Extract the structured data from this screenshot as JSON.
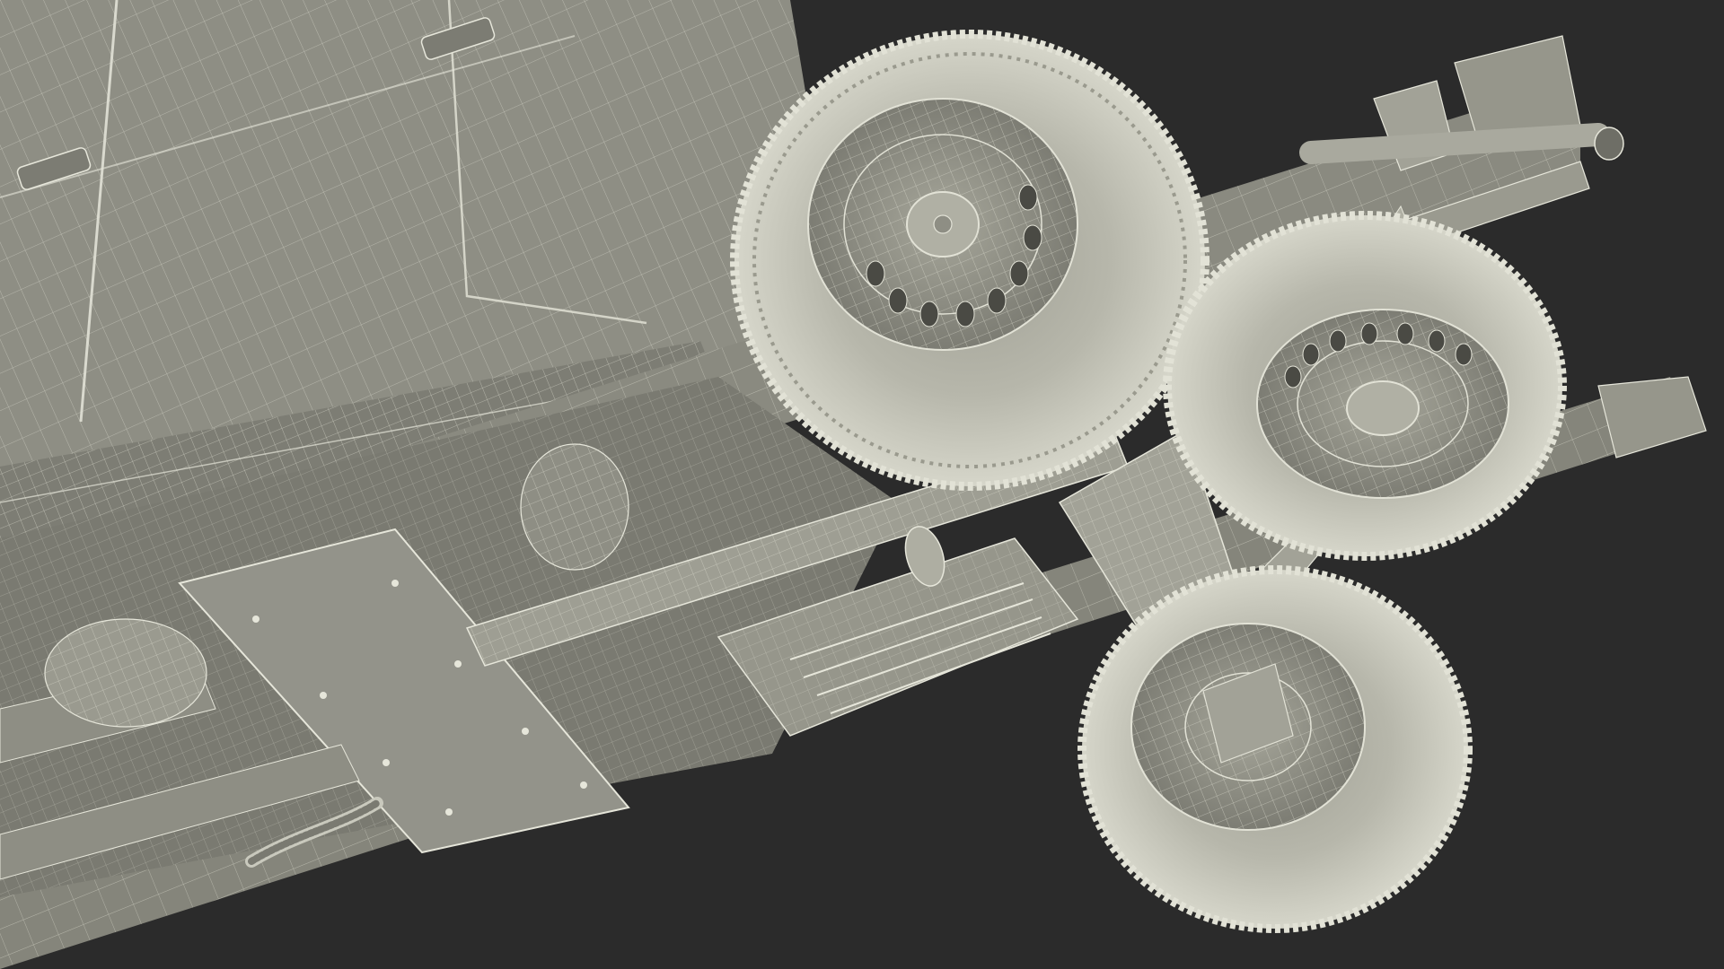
{
  "scene": {
    "background_color": "#2b2b2b",
    "body_color": "#8e8e84",
    "body_shadow_color": "#6a6a62",
    "wire_color": "#d8d8cc",
    "tire_color": "#c9c9bd",
    "tire_shadow_color": "#9a9a8e",
    "subject": "wireframe-render-pickup-truck-underside",
    "wheel_icons": [
      "wheel-icon",
      "wheel-icon",
      "wheel-icon"
    ]
  }
}
